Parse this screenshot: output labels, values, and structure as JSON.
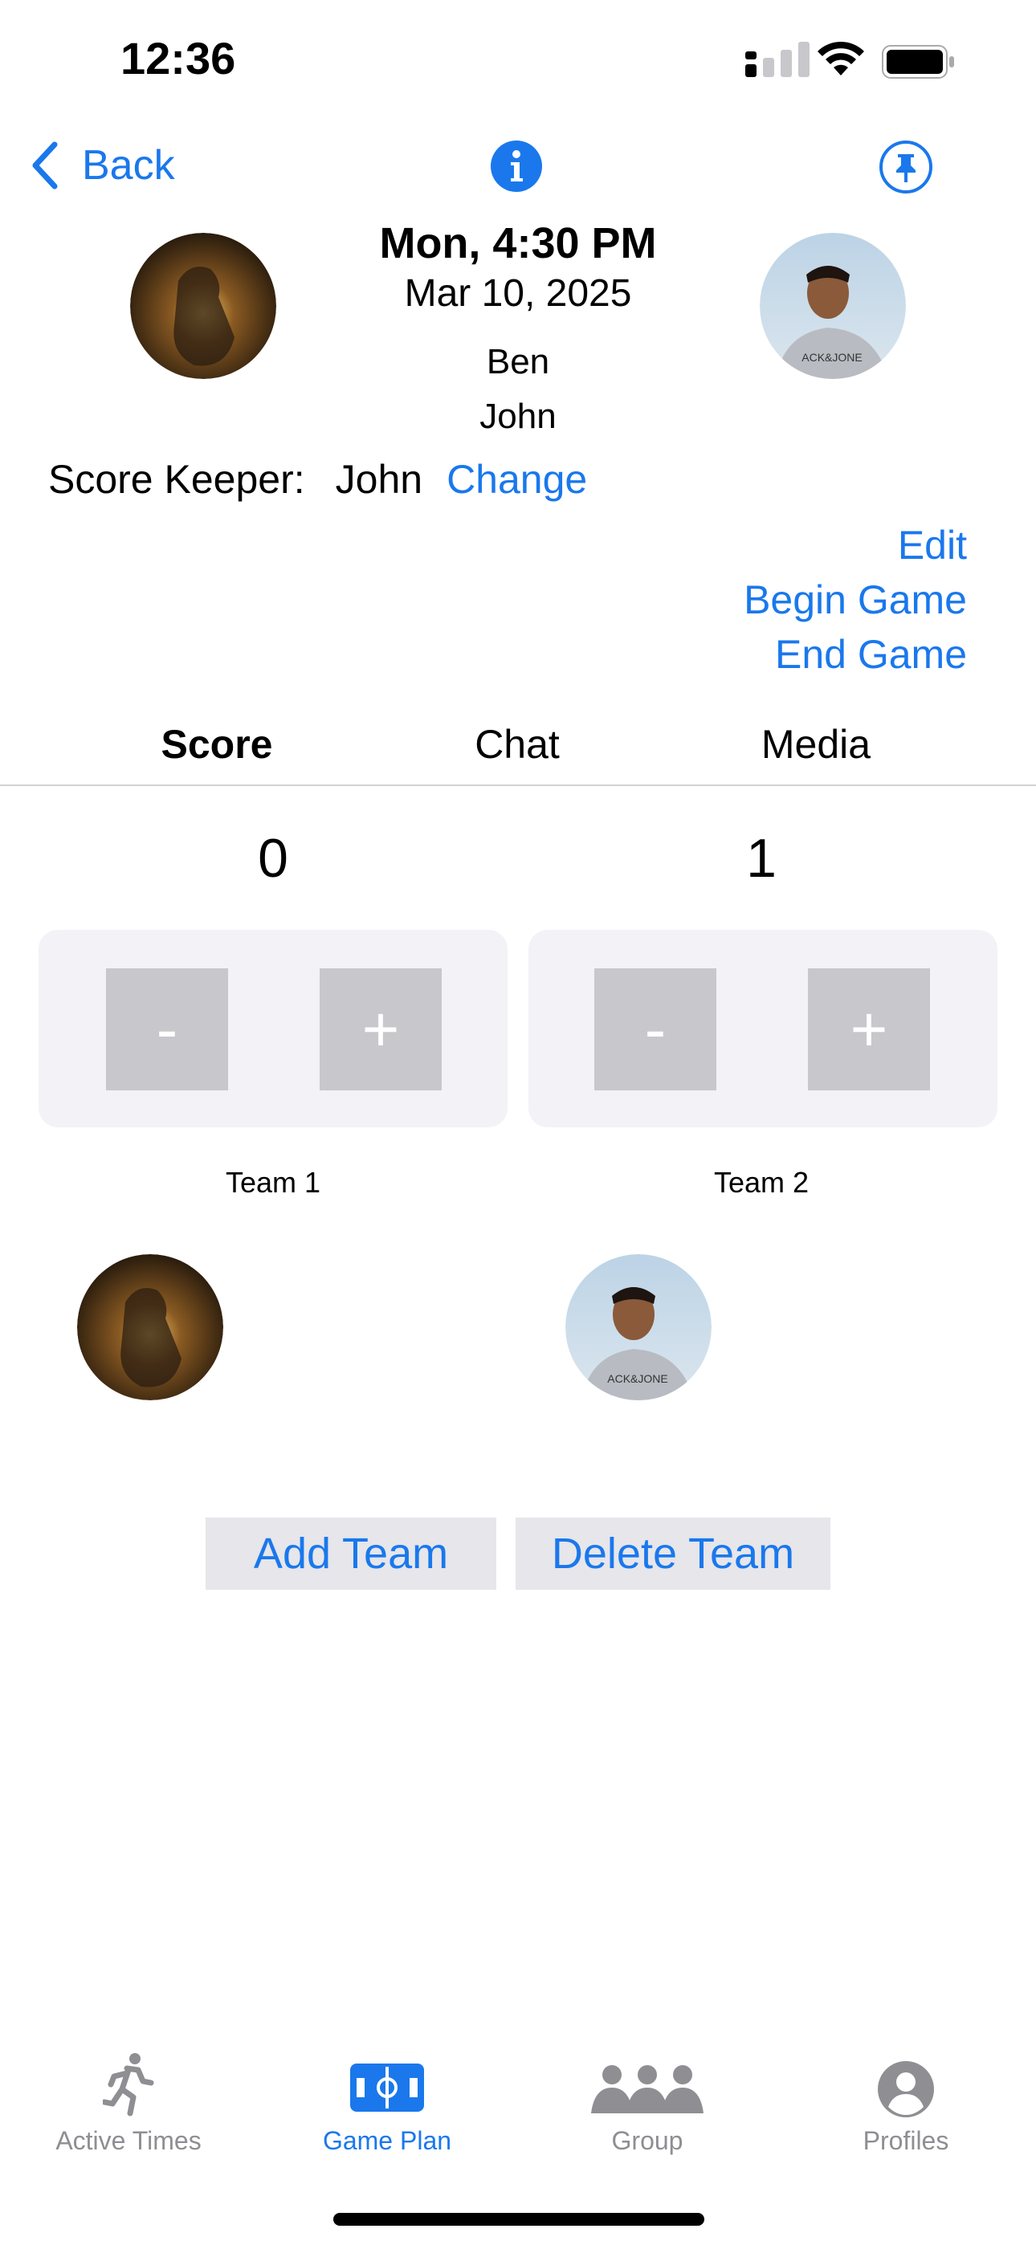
{
  "status": {
    "time": "12:36"
  },
  "nav": {
    "back_label": "Back"
  },
  "game": {
    "day_time": "Mon, 4:30 PM",
    "date": "Mar 10, 2025",
    "players": [
      "Ben",
      "John"
    ],
    "score_keeper_label": "Score Keeper:",
    "score_keeper_name": "John",
    "change_label": "Change",
    "edit_label": "Edit",
    "begin_label": "Begin Game",
    "end_label": "End Game"
  },
  "tabs": [
    "Score",
    "Chat",
    "Media"
  ],
  "teams": [
    {
      "score": "0",
      "minus": "-",
      "plus": "+",
      "name": "Team 1"
    },
    {
      "score": "1",
      "minus": "-",
      "plus": "+",
      "name": "Team 2"
    }
  ],
  "actions": {
    "add_team": "Add Team",
    "delete_team": "Delete Team"
  },
  "tabbar": [
    {
      "label": "Active Times",
      "icon": "runner-icon"
    },
    {
      "label": "Game Plan",
      "icon": "field-icon",
      "active": true
    },
    {
      "label": "Group",
      "icon": "group-icon"
    },
    {
      "label": "Profiles",
      "icon": "profile-icon"
    }
  ],
  "colors": {
    "accent": "#1a78ec",
    "inactive": "#8e8e93",
    "panel": "#f2f2f7",
    "button": "#c7c7cc"
  }
}
